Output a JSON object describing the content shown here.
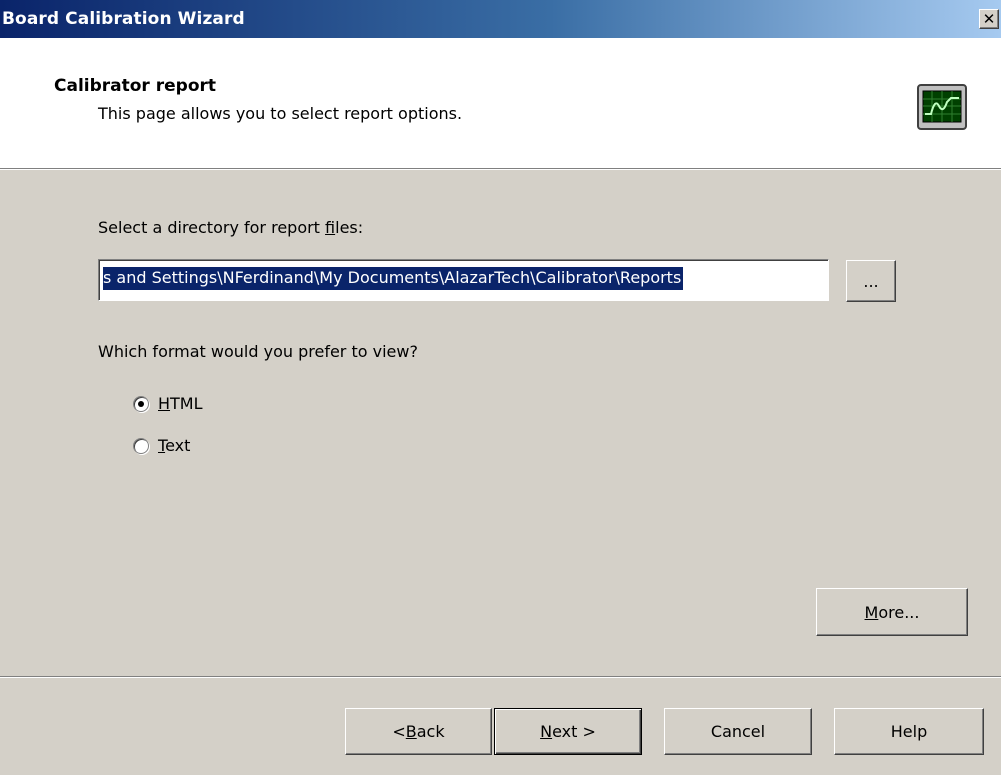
{
  "window": {
    "title": "Board Calibration Wizard",
    "close_glyph": "✕"
  },
  "header": {
    "title": "Calibrator report",
    "subtitle": "This page allows you to select report options.",
    "icon": "oscilloscope-icon"
  },
  "directory": {
    "label_pre": "Select a directory for report ",
    "label_u": "f",
    "label_post": "iles:",
    "value": "s and Settings\\NFerdinand\\My Documents\\AlazarTech\\Calibrator\\Reports",
    "browse_label": "..."
  },
  "format": {
    "question": "Which format would you prefer to view?",
    "options": [
      {
        "u": "H",
        "rest": "TML",
        "checked": true
      },
      {
        "u": "T",
        "rest": "ext",
        "checked": false
      }
    ]
  },
  "more_button": {
    "u": "M",
    "rest": "ore..."
  },
  "footer": {
    "back": {
      "pre": "< ",
      "u": "B",
      "rest": "ack"
    },
    "next": {
      "u": "N",
      "rest": "ext >"
    },
    "cancel": "Cancel",
    "help": "Help"
  },
  "colors": {
    "title_gradient_start": "#0a246a",
    "title_gradient_end": "#a6caf0",
    "face": "#d4d0c8",
    "selection": "#0a246a"
  }
}
